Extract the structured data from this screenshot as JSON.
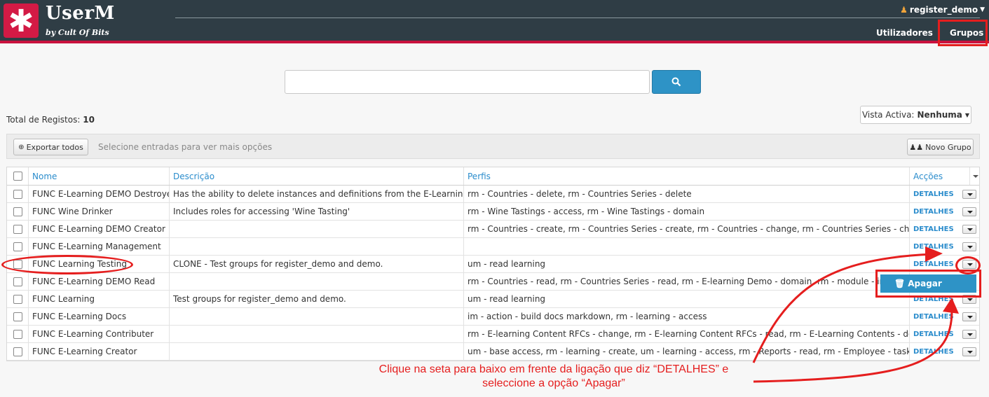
{
  "header": {
    "logo_glyph": "✱",
    "brand": "UserM",
    "brand_sub": "by Cult Of Bits",
    "user": "register_demo",
    "nav": [
      "Utilizadores",
      "Grupos"
    ]
  },
  "search": {
    "placeholder": "",
    "button_icon": "search-icon"
  },
  "summary": {
    "label": "Total de Registos:",
    "count": "10"
  },
  "view": {
    "label": "Vista Activa:",
    "value": "Nenhuma"
  },
  "toolbar": {
    "export_label": "Exportar todos",
    "hint": "Selecione entradas para ver mais opções",
    "new_label": "Novo Grupo"
  },
  "table": {
    "columns": [
      "Nome",
      "Descrição",
      "Perfis",
      "Acções"
    ],
    "action_label": "DETALHES",
    "rows": [
      {
        "nome": "FUNC E-Learning DEMO Destroyer",
        "desc": "Has the ability to delete instances and definitions from the E-Learning De...",
        "perfis": "rm - Countries - delete, rm - Countries Series - delete"
      },
      {
        "nome": "FUNC Wine Drinker",
        "desc": "Includes roles for accessing 'Wine Tasting'",
        "perfis": "rm - Wine Tastings - access, rm - Wine Tastings - domain"
      },
      {
        "nome": "FUNC E-Learning DEMO Creator",
        "desc": "",
        "perfis": "rm - Countries - create, rm - Countries Series - create, rm - Countries - change, rm - Countries Series - change, r..."
      },
      {
        "nome": "FUNC E-Learning Management",
        "desc": "",
        "perfis": ""
      },
      {
        "nome": "FUNC Learning Testing",
        "desc": "CLONE - Test groups for register_demo and demo.",
        "perfis": "um - read learning"
      },
      {
        "nome": "FUNC E-Learning DEMO Read",
        "desc": "",
        "perfis": "rm - Countries - read, rm - Countries Series - read, rm - E-learning Demo - domain, rm - module - instance de"
      },
      {
        "nome": "FUNC Learning",
        "desc": "Test groups for register_demo and demo.",
        "perfis": "um - read learning"
      },
      {
        "nome": "FUNC E-Learning Docs",
        "desc": "",
        "perfis": "im - action - build docs markdown, rm - learning - access"
      },
      {
        "nome": "FUNC E-Learning Contributer",
        "desc": "",
        "perfis": "rm - E-learning Content RFCs - change, rm - E-learning Content RFCs - read, rm - E-Learning Contents - domain, R..."
      },
      {
        "nome": "FUNC E-Learning Creator",
        "desc": "",
        "perfis": "um - base access, rm - learning - create, um - learning - access, rm - Reports - read, rm - Employee - tasks"
      }
    ]
  },
  "dropdown": {
    "label": "Apagar",
    "icon": "trash-icon"
  },
  "annotation": {
    "line1": "Clique na seta para baixo em frente da ligação que diz “DETALHES” e",
    "line2": "seleccione a opção “Apagar”",
    "color": "#e51e1e"
  }
}
